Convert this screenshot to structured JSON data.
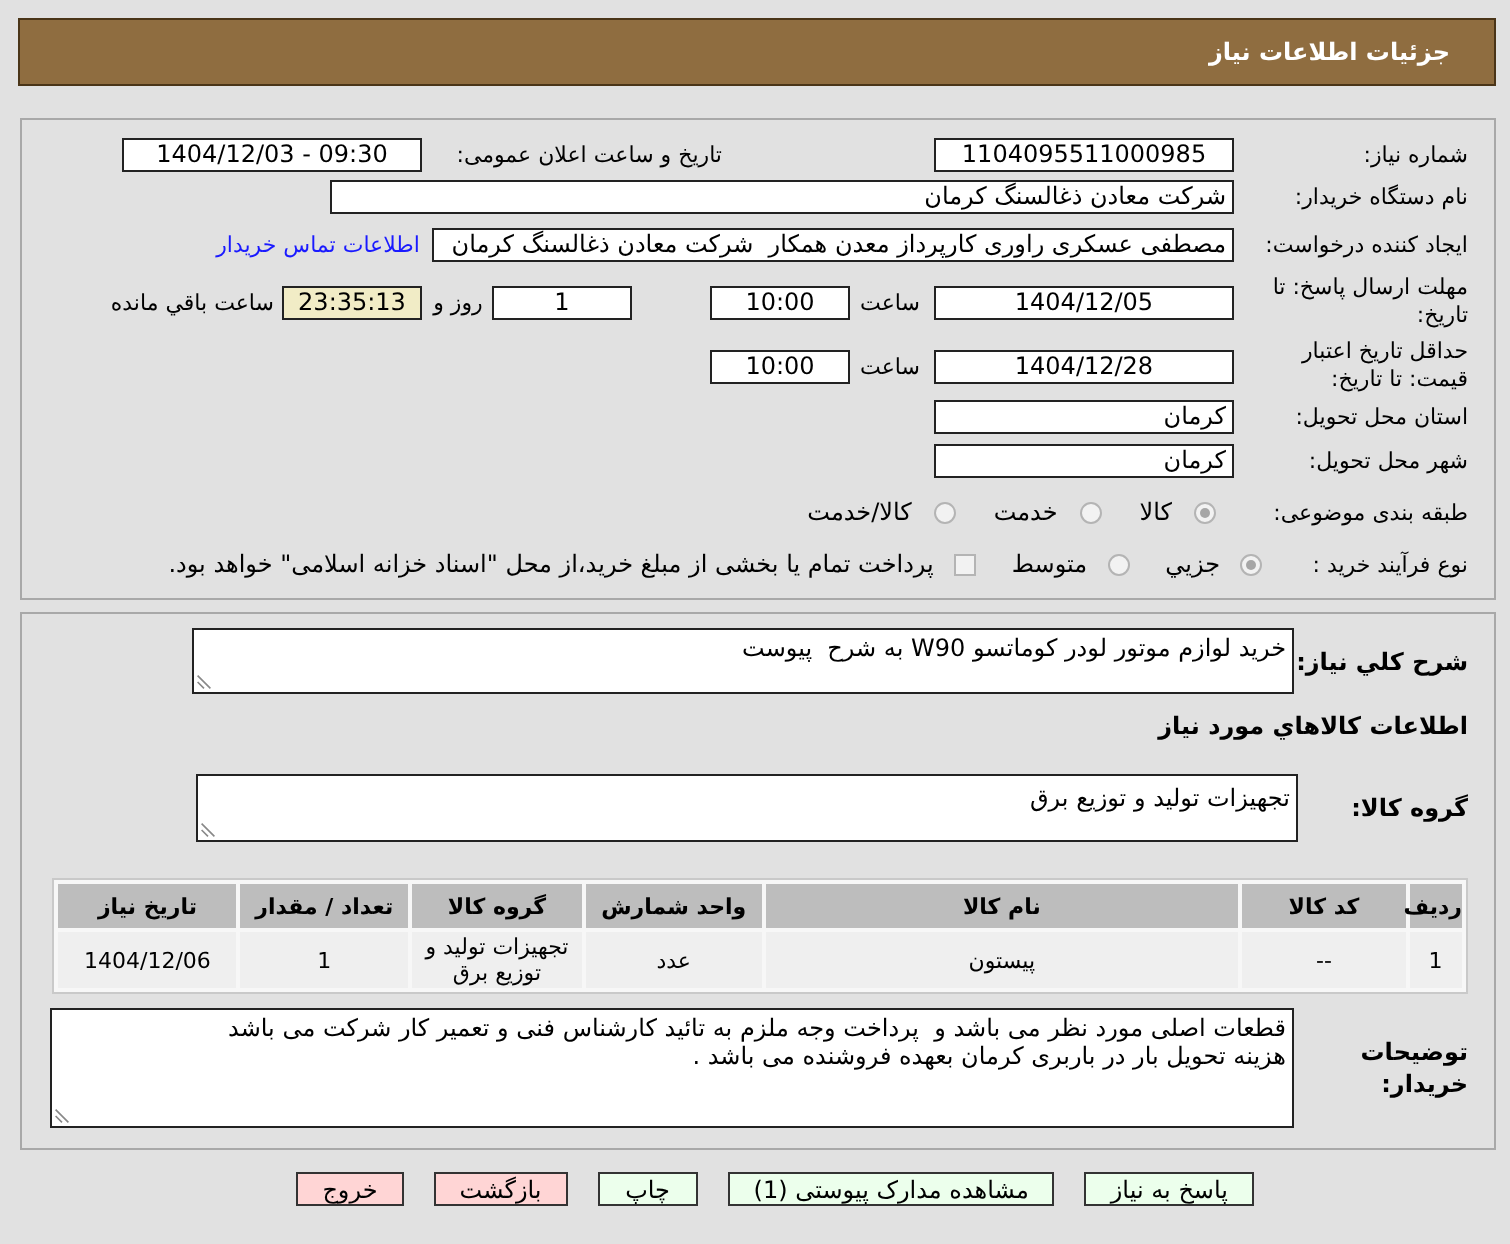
{
  "header": {
    "title": "جزئیات اطلاعات نیاز"
  },
  "need_number": {
    "label": "شماره نیاز:",
    "value": "1104095511000985"
  },
  "announce": {
    "label": "تاریخ و ساعت اعلان عمومی:",
    "value": "1404/12/03 - 09:30"
  },
  "buyer_org": {
    "label": "نام دستگاه خریدار:",
    "value": "شرکت معادن ذغالسنگ کرمان"
  },
  "requester": {
    "label": "ایجاد کننده درخواست:",
    "value": "مصطفی عسکری راوری کارپرداز معدن همکار  شرکت معادن ذغالسنگ کرمان",
    "link": "اطلاعات تماس خریدار"
  },
  "response_deadline": {
    "label": "مهلت ارسال پاسخ: تا تاریخ:",
    "date": "1404/12/05",
    "time_label": "ساعت",
    "time": "10:00",
    "days": "1",
    "days_label": "روز و",
    "remaining": "23:35:13",
    "remaining_label": "ساعت باقي مانده"
  },
  "price_validity": {
    "label": "حداقل تاریخ اعتبار قیمت: تا تاریخ:",
    "date": "1404/12/28",
    "time_label": "ساعت",
    "time": "10:00"
  },
  "province": {
    "label": "استان محل تحویل:",
    "value": "کرمان"
  },
  "city": {
    "label": "شهر محل تحویل:",
    "value": "کرمان"
  },
  "category": {
    "label": "طبقه بندی موضوعی:",
    "options": [
      {
        "label": "کالا",
        "selected": true
      },
      {
        "label": "خدمت",
        "selected": false
      },
      {
        "label": "کالا/خدمت",
        "selected": false
      }
    ]
  },
  "process": {
    "label": "نوع فرآیند خرید :",
    "options": [
      {
        "label": "جزيي",
        "selected": true
      },
      {
        "label": "متوسط",
        "selected": false
      }
    ],
    "treasury": {
      "label": "پرداخت تمام یا بخشی از مبلغ خرید،از محل \"اسناد خزانه اسلامی\" خواهد بود.",
      "checked": false
    }
  },
  "summary": {
    "label": "شرح كلي نياز:",
    "value": "خرید لوازم موتور لودر کوماتسو W90 به شرح  پیوست"
  },
  "goods_heading": "اطلاعات كالاهاي مورد نياز",
  "goods_group": {
    "label": "گروه کالا:",
    "value": "تجهیزات تولید و توزیع برق"
  },
  "table": {
    "columns": [
      "ردیف",
      "کد کالا",
      "نام کالا",
      "واحد شمارش",
      "گروه کالا",
      "تعداد / مقدار",
      "تاریخ نیاز"
    ],
    "rows": [
      [
        "1",
        "--",
        "پیستون",
        "عدد",
        "تجهیزات تولید و توزیع برق",
        "1",
        "1404/12/06"
      ]
    ]
  },
  "buyer_notes": {
    "label": "توضیحات خریدار:",
    "value": "قطعات اصلی مورد نظر می باشد و  پرداخت وجه ملزم به تائید کارشناس فنی و تعمیر کار شرکت می باشد\nهزینه تحویل بار در باربری کرمان بعهده فروشنده می باشد ."
  },
  "buttons": [
    {
      "label": "پاسخ به نیاز",
      "kind": "normal"
    },
    {
      "label": "مشاهده مدارک پیوستی (1)",
      "kind": "normal"
    },
    {
      "label": "چاپ",
      "kind": "normal"
    },
    {
      "label": "بازگشت",
      "kind": "danger"
    },
    {
      "label": "خروج",
      "kind": "danger"
    }
  ]
}
